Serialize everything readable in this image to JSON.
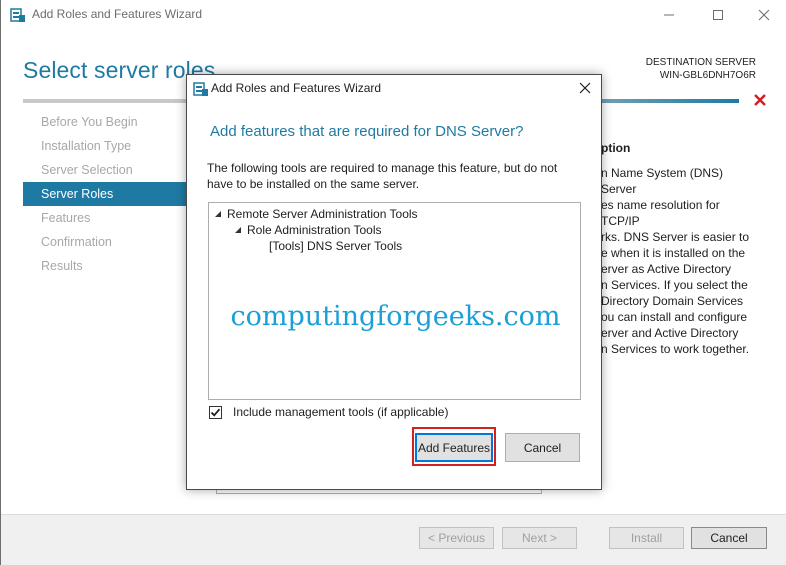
{
  "window": {
    "title": "Add Roles and Features Wizard",
    "controls": {
      "minimize": "minimize-icon",
      "maximize": "maximize-icon",
      "close": "close-icon"
    }
  },
  "header": {
    "title": "Select server roles",
    "destination_label": "DESTINATION SERVER",
    "destination_server": "WIN-GBL6DNH7O6R"
  },
  "nav": {
    "items": [
      {
        "label": "Before You Begin",
        "active": false
      },
      {
        "label": "Installation Type",
        "active": false
      },
      {
        "label": "Server Selection",
        "active": false
      },
      {
        "label": "Server Roles",
        "active": true
      },
      {
        "label": "Features",
        "active": false
      },
      {
        "label": "Confirmation",
        "active": false
      },
      {
        "label": "Results",
        "active": false
      }
    ]
  },
  "description": {
    "title": "ption",
    "lines": [
      "n Name System (DNS) Server",
      "es name resolution for TCP/IP",
      "rks. DNS Server is easier to",
      "e when it is installed on the",
      "erver as Active Directory",
      "n Services. If you select the",
      "Directory Domain Services",
      "ou can install and configure",
      "erver and Active Directory",
      "n Services to work together."
    ]
  },
  "footer": {
    "previous": "< Previous",
    "next": "Next >",
    "install": "Install",
    "cancel": "Cancel"
  },
  "dialog": {
    "title": "Add Roles and Features Wizard",
    "heading": "Add features that are required for DNS Server?",
    "description": "The following tools are required to manage this feature, but do not have to be installed on the same server.",
    "tree": [
      {
        "label": "Remote Server Administration Tools",
        "level": 0,
        "expanded": true
      },
      {
        "label": "Role Administration Tools",
        "level": 1,
        "expanded": true
      },
      {
        "label": "[Tools] DNS Server Tools",
        "level": 2,
        "expanded": false
      }
    ],
    "watermark": "computingforgeeks.com",
    "checkbox_label": "Include management tools (if applicable)",
    "checkbox_checked": true,
    "add_button": "Add Features",
    "cancel_button": "Cancel"
  },
  "colors": {
    "accent": "#1e7aa3",
    "highlight": "#d42020",
    "watermark": "#1aa0d8",
    "error": "#d42020"
  }
}
